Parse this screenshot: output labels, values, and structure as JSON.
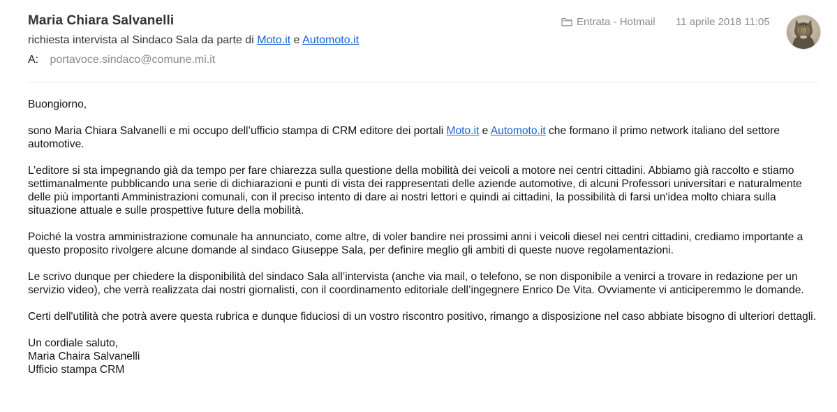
{
  "header": {
    "sender": "Maria Chiara Salvanelli",
    "subject_prefix": "richiesta intervista al Sindaco Sala da parte di ",
    "subject_link1": "Moto.it",
    "subject_between": " e ",
    "subject_link2": "Automoto.it",
    "to_label": "A:",
    "to_value": "portavoce.sindaco@comune.mi.it",
    "mailbox": "Entrata - Hotmail",
    "date": "11 aprile 2018 11:05",
    "mailbox_icon": "folder-icon",
    "avatar_icon": "cat-avatar"
  },
  "body": {
    "greeting": "Buongiorno,",
    "p1_part1": "sono Maria Chiara Salvanelli e mi occupo dell’ufficio stampa di CRM editore dei portali ",
    "p1_link1": "Moto.it",
    "p1_part2": " e ",
    "p1_link2": "Automoto.it",
    "p1_part3": " che formano il primo network italiano del settore automotive.",
    "p2": "L’editore si sta impegnando già da tempo per fare chiarezza sulla questione della mobilità dei veicoli a motore nei centri cittadini. Abbiamo già raccolto e stiamo settimanalmente pubblicando una serie di dichiarazioni e punti di vista dei rappresentati delle aziende automotive, di alcuni Professori universitari e naturalmente delle più importanti Amministrazioni comunali, con il preciso intento di dare ai nostri lettori e quindi ai cittadini, la possibilità di farsi un'idea molto chiara sulla situazione attuale e sulle prospettive future della mobilità.",
    "p3": "Poiché la vostra amministrazione comunale ha annunciato, come altre, di voler bandire nei prossimi anni i veicoli diesel nei centri cittadini, crediamo importante a questo proposito rivolgere alcune domande al sindaco Giuseppe Sala, per definire meglio gli ambiti di queste nuove regolamentazioni.",
    "p4": "Le scrivo dunque per chiedere la disponibilità del sindaco Sala all’intervista (anche via mail, o telefono, se non disponibile a venirci a trovare in redazione per un servizio video), che verrà realizzata dai nostri giornalisti, con il coordinamento editoriale dell’ingegnere Enrico De Vita. Ovviamente vi anticiperemmo le domande.",
    "p5": "Certi dell'utilità che potrà avere questa rubrica e dunque fiduciosi di un vostro riscontro positivo, rimango a disposizione nel caso abbiate bisogno di ulteriori dettagli.",
    "sig_line1": "Un cordiale saluto,",
    "sig_line2": "Maria Chaira Salvanelli",
    "sig_line3": "Ufficio stampa CRM"
  },
  "colors": {
    "link": "#1a5fd0",
    "meta_gray": "#8a8a8a",
    "sender_text": "#333333"
  }
}
